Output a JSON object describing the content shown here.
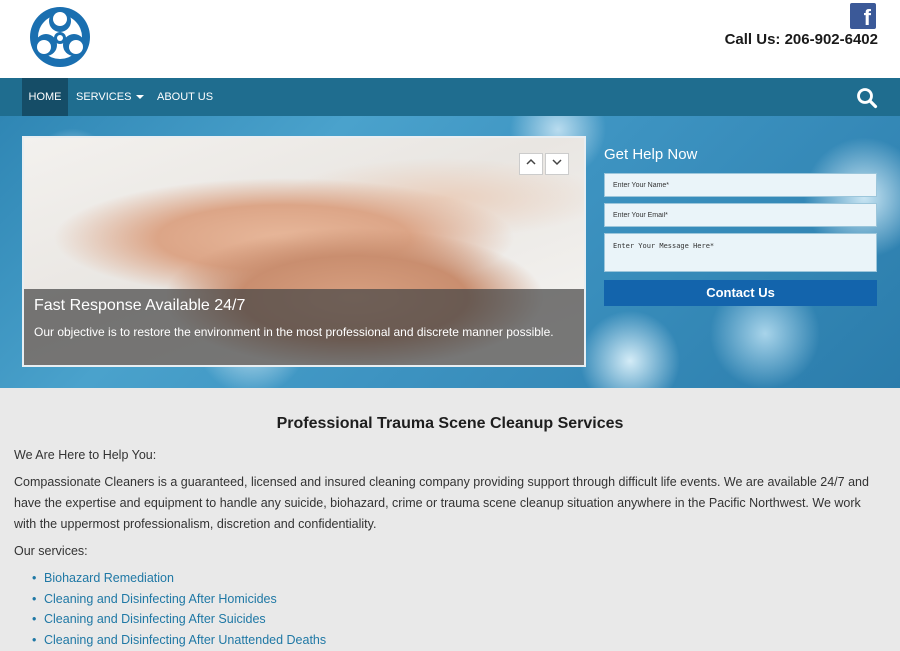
{
  "header": {
    "phone": "Call Us: 206-902-6402",
    "social_icon": "facebook-icon"
  },
  "nav": {
    "items": [
      {
        "label": "HOME"
      },
      {
        "label": "SERVICES"
      },
      {
        "label": "ABOUT US"
      }
    ],
    "search_icon": "search-icon"
  },
  "slider": {
    "title": "Fast Response Available 24/7",
    "text": "Our objective is to restore the environment in the most professional and discrete manner possible."
  },
  "form": {
    "title": "Get Help Now",
    "name_placeholder": "Enter Your Name*",
    "email_placeholder": "Enter Your Email*",
    "message_placeholder": "Enter Your Message Here*",
    "submit_label": "Contact Us"
  },
  "content": {
    "heading": "Professional Trauma Scene Cleanup Services",
    "intro": "We Are Here to Help You:",
    "paragraph": "Compassionate Cleaners is a guaranteed, licensed and insured cleaning company providing support through difficult life events. We are available 24/7 and have the expertise and equipment to handle any suicide, biohazard, crime or trauma scene cleanup situation anywhere in the Pacific Northwest. We work with the uppermost professionalism, discretion and confidentiality.",
    "services_label": "Our services:",
    "services": [
      "Biohazard Remediation",
      "Cleaning and Disinfecting After Homicides",
      "Cleaning and Disinfecting After Suicides",
      "Cleaning and Disinfecting After Unattended Deaths"
    ]
  },
  "colors": {
    "nav": "#1f6d8f",
    "nav_active": "#154d67",
    "button": "#1364ac",
    "link": "#1f78a5"
  }
}
